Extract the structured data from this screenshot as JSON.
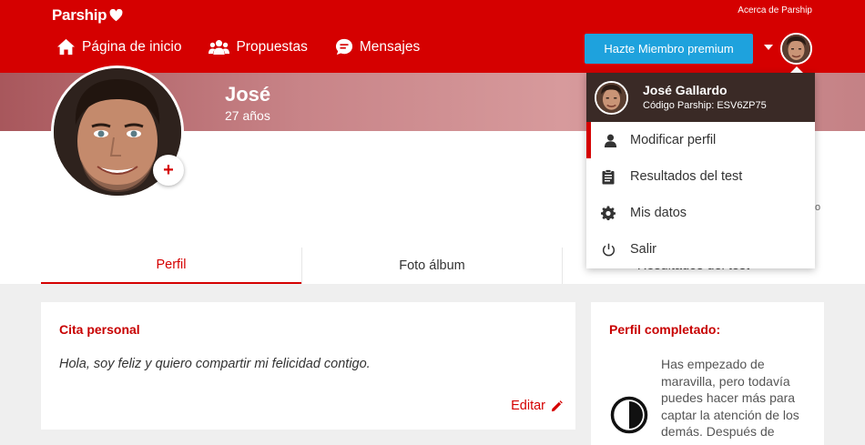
{
  "brand": {
    "name": "Parship",
    "color": "#d50000"
  },
  "header": {
    "about_link": "Acerca de Parship",
    "nav": [
      {
        "label": "Página de inicio",
        "icon": "home-icon"
      },
      {
        "label": "Propuestas",
        "icon": "people-icon"
      },
      {
        "label": "Mensajes",
        "icon": "chat-icon"
      }
    ],
    "premium_button": "Hazte Miembro premium",
    "premium_color": "#1ea2dd"
  },
  "profile": {
    "name": "José",
    "age": "27 años"
  },
  "tabs": [
    "Perfil",
    "Foto álbum",
    "Resultados del test"
  ],
  "stray_char": "o",
  "quote_card": {
    "title": "Cita personal",
    "text": "Hola, soy feliz y quiero compartir mi felicidad contigo.",
    "edit_label": "Editar"
  },
  "completed_card": {
    "title": "Perfil completado:",
    "text": "Has empezado de maravilla, pero todavía puedes hacer más para captar la atención de los demás. Después de"
  },
  "dropdown": {
    "user_name": "José Gallardo",
    "user_code": "Código Parship: ESV6ZP75",
    "items": [
      {
        "label": "Modificar perfil",
        "icon": "user-icon"
      },
      {
        "label": "Resultados del test",
        "icon": "clipboard-icon"
      },
      {
        "label": "Mis datos",
        "icon": "gear-icon"
      },
      {
        "label": "Salir",
        "icon": "power-icon"
      }
    ]
  }
}
